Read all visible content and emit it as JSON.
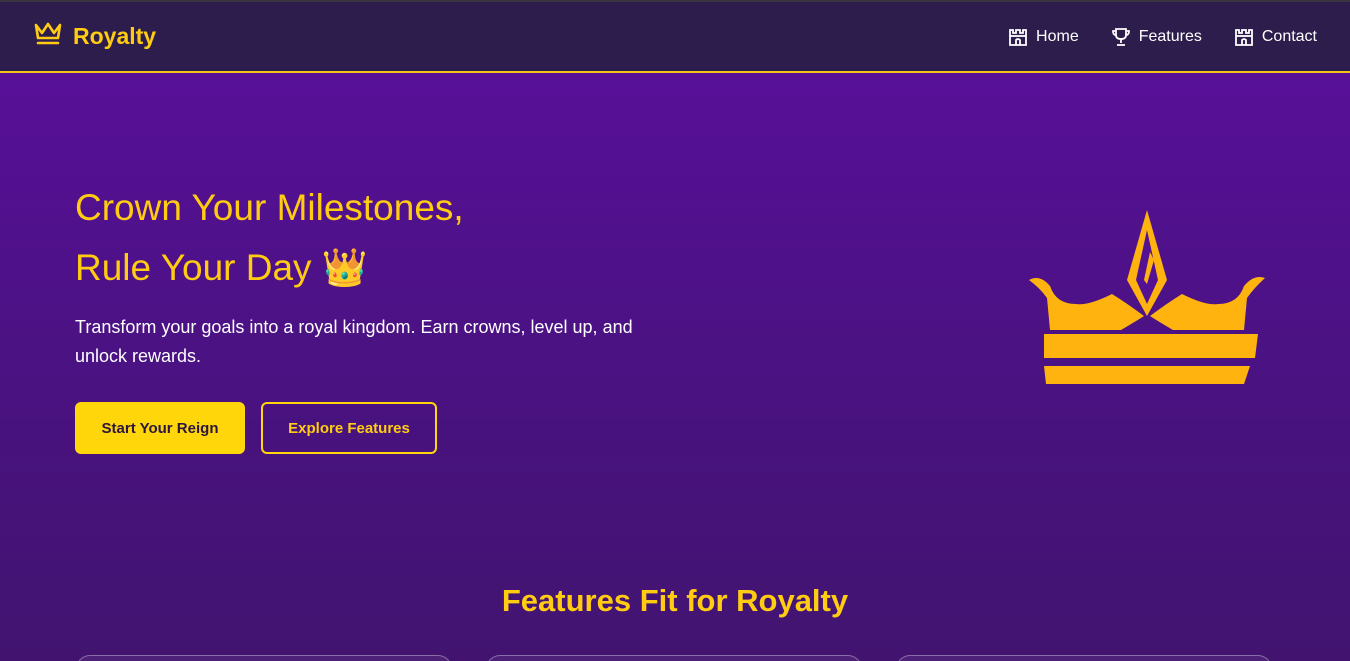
{
  "brand": {
    "name": "Royalty",
    "icon": "crown-outline-icon",
    "color": "#ffcc11"
  },
  "nav": {
    "items": [
      {
        "label": "Home",
        "icon": "castle-icon"
      },
      {
        "label": "Features",
        "icon": "trophy-icon"
      },
      {
        "label": "Contact",
        "icon": "castle-icon"
      }
    ]
  },
  "hero": {
    "title_line1": "Crown Your Milestones,",
    "title_line2": "Rule Your Day",
    "title_emoji": "👑",
    "subtitle": "Transform your goals into a royal kingdom. Earn crowns, level up, and unlock rewards.",
    "primary_button": "Start Your Reign",
    "secondary_button": "Explore Features",
    "illustration_icon": "large-crown-icon"
  },
  "features": {
    "title": "Features Fit for Royalty"
  },
  "colors": {
    "accent": "#ffd60a",
    "header_bg": "#2d1d4c",
    "hero_bg_top": "#5b0f9e",
    "hero_bg_bottom": "#421470",
    "crown_gold": "#ffb30f"
  }
}
